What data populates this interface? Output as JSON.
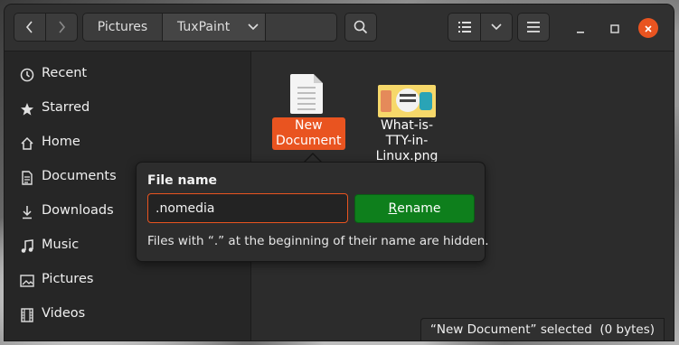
{
  "header": {
    "breadcrumbs": [
      "Pictures",
      "TuxPaint"
    ],
    "back_icon": "chevron-left-icon",
    "forward_icon": "chevron-right-icon",
    "search_icon": "search-icon",
    "view_icon": "list-view-icon",
    "menu_icon": "hamburger-menu-icon"
  },
  "sidebar": {
    "items": [
      {
        "label": "Recent",
        "icon": "clock-icon"
      },
      {
        "label": "Starred",
        "icon": "star-icon"
      },
      {
        "label": "Home",
        "icon": "home-icon"
      },
      {
        "label": "Documents",
        "icon": "document-icon"
      },
      {
        "label": "Downloads",
        "icon": "download-icon"
      },
      {
        "label": "Music",
        "icon": "music-note-icon"
      },
      {
        "label": "Pictures",
        "icon": "image-icon"
      },
      {
        "label": "Videos",
        "icon": "film-icon"
      }
    ]
  },
  "files": [
    {
      "name": "New Document",
      "name_lines": [
        "New",
        "Document"
      ],
      "selected": true,
      "icon": "text-document-icon"
    },
    {
      "name": "What-is-TTY-in-Linux.png",
      "name_lines": [
        "What-is-",
        "TTY-in-",
        "Linux.png"
      ],
      "selected": false,
      "icon": "image-thumbnail"
    }
  ],
  "rename": {
    "title": "File name",
    "value": ".nomedia",
    "button_mnemonic": "R",
    "button_rest": "ename",
    "hint": "Files with “.” at the beginning of their name are hidden."
  },
  "status": {
    "text": "“New Document” selected  (0 bytes)"
  },
  "colors": {
    "accent": "#e95420",
    "rename_button": "#0e7f1c",
    "window_bg": "#2c2c2c"
  }
}
